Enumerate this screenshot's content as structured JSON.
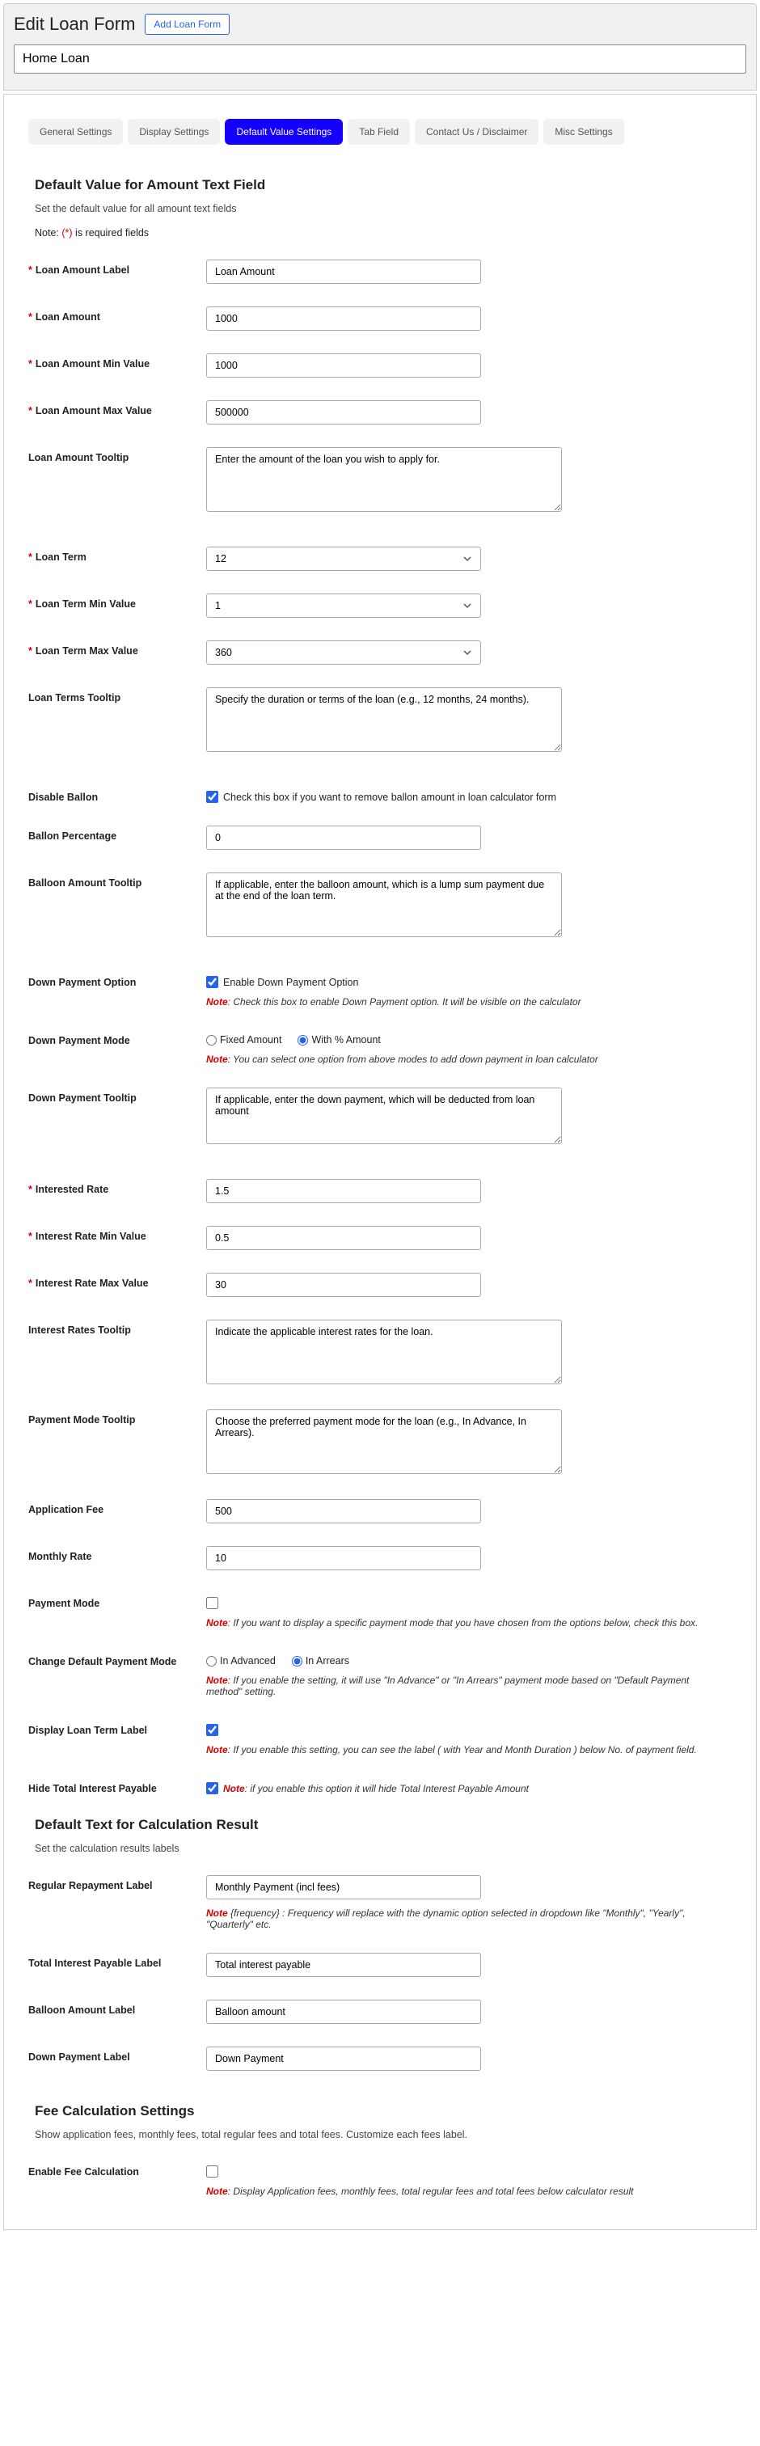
{
  "header": {
    "title": "Edit Loan Form",
    "add_button": "Add Loan Form",
    "form_name": "Home Loan"
  },
  "tabs": {
    "items": [
      {
        "label": "General Settings",
        "active": false
      },
      {
        "label": "Display Settings",
        "active": false
      },
      {
        "label": "Default Value Settings",
        "active": true
      },
      {
        "label": "Tab Field",
        "active": false
      },
      {
        "label": "Contact Us / Disclaimer",
        "active": false
      },
      {
        "label": "Misc Settings",
        "active": false
      }
    ]
  },
  "section_amount": {
    "heading": "Default Value for Amount Text Field",
    "subtitle": "Set the default value for all amount text fields",
    "note_prefix": "Note: ",
    "note_star": "(*)",
    "note_suffix": " is required fields"
  },
  "fields": {
    "loan_amount_label": {
      "label": "Loan Amount Label",
      "value": "Loan Amount"
    },
    "loan_amount": {
      "label": "Loan Amount",
      "value": "1000"
    },
    "loan_amount_min": {
      "label": "Loan Amount Min Value",
      "value": "1000"
    },
    "loan_amount_max": {
      "label": "Loan Amount Max Value",
      "value": "500000"
    },
    "loan_amount_tooltip": {
      "label": "Loan Amount Tooltip",
      "value": "Enter the amount of the loan you wish to apply for."
    },
    "loan_term": {
      "label": "Loan Term",
      "value": "12"
    },
    "loan_term_min": {
      "label": "Loan Term Min Value",
      "value": "1"
    },
    "loan_term_max": {
      "label": "Loan Term Max Value",
      "value": "360"
    },
    "loan_terms_tooltip": {
      "label": "Loan Terms Tooltip",
      "value": "Specify the duration or terms of the loan (e.g., 12 months, 24 months)."
    },
    "disable_ballon": {
      "label": "Disable Ballon",
      "check_text": "Check this box if you want to remove ballon amount in loan calculator form",
      "checked": true
    },
    "ballon_percentage": {
      "label": "Ballon Percentage",
      "value": "0"
    },
    "balloon_tooltip": {
      "label": "Balloon Amount Tooltip",
      "value": "If applicable, enter the balloon amount, which is a lump sum payment due at the end of the loan term."
    },
    "down_payment_option": {
      "label": "Down Payment Option",
      "check_text": "Enable Down Payment Option",
      "checked": true,
      "note_label": "Note",
      "note_text": ": Check this box to enable Down Payment option. It will be visible on the calculator"
    },
    "down_payment_mode": {
      "label": "Down Payment Mode",
      "opt_fixed": "Fixed Amount",
      "opt_percent": "With % Amount",
      "selected": "percent",
      "note_label": "Note",
      "note_text": ": You can select one option from above modes to add down payment in loan calculator"
    },
    "down_payment_tooltip": {
      "label": "Down Payment Tooltip",
      "value": "If applicable, enter the down payment, which will be deducted from loan amount"
    },
    "interest_rate": {
      "label": "Interested Rate",
      "value": "1.5"
    },
    "interest_rate_min": {
      "label": "Interest Rate Min Value",
      "value": "0.5"
    },
    "interest_rate_max": {
      "label": "Interest Rate Max Value",
      "value": "30"
    },
    "interest_rates_tooltip": {
      "label": "Interest Rates Tooltip",
      "value": "Indicate the applicable interest rates for the loan."
    },
    "payment_mode_tooltip": {
      "label": "Payment Mode Tooltip",
      "value": "Choose the preferred payment mode for the loan (e.g., In Advance, In Arrears)."
    },
    "application_fee": {
      "label": "Application Fee",
      "value": "500"
    },
    "monthly_rate": {
      "label": "Monthly Rate",
      "value": "10"
    },
    "payment_mode": {
      "label": "Payment Mode",
      "checked": false,
      "note_label": "Note",
      "note_text": ": If you want to display a specific payment mode that you have chosen from the options below, check this box."
    },
    "change_default_payment_mode": {
      "label": "Change Default Payment Mode",
      "opt_advanced": "In Advanced",
      "opt_arrears": "In Arrears",
      "selected": "arrears",
      "note_label": "Note",
      "note_text": ": If you enable the setting, it will use \"In Advance\" or \"In Arrears\" payment mode based on \"Default Payment method\" setting."
    },
    "display_loan_term_label": {
      "label": "Display Loan Term Label",
      "checked": true,
      "note_label": "Note",
      "note_text": ": If you enable this setting, you can see the label ( with Year and Month Duration ) below No. of payment field."
    },
    "hide_total_interest": {
      "label": "Hide Total Interest Payable",
      "checked": true,
      "note_label": "Note",
      "note_text": ": if you enable this option it will hide Total Interest Payable Amount"
    }
  },
  "section_calc": {
    "heading": "Default Text for Calculation Result",
    "subtitle": "Set the calculation results labels"
  },
  "calc_fields": {
    "regular_repayment": {
      "label": "Regular Repayment Label",
      "value": "Monthly Payment (incl fees)",
      "note_label": "Note",
      "note_text": " {frequency} : Frequency will replace with the dynamic option selected in dropdown like \"Monthly\", \"Yearly\", \"Quarterly\" etc."
    },
    "total_interest_label": {
      "label": "Total Interest Payable Label",
      "value": "Total interest payable"
    },
    "balloon_amount_label": {
      "label": "Balloon Amount Label",
      "value": "Balloon amount"
    },
    "down_payment_label": {
      "label": "Down Payment Label",
      "value": "Down Payment"
    }
  },
  "section_fee": {
    "heading": "Fee Calculation Settings",
    "subtitle": "Show application fees, monthly fees, total regular fees and total fees. Customize each fees label."
  },
  "fee_fields": {
    "enable_fee": {
      "label": "Enable Fee Calculation",
      "checked": false,
      "note_label": "Note",
      "note_text": ": Display Application fees, monthly fees, total regular fees and total fees below calculator result"
    }
  }
}
